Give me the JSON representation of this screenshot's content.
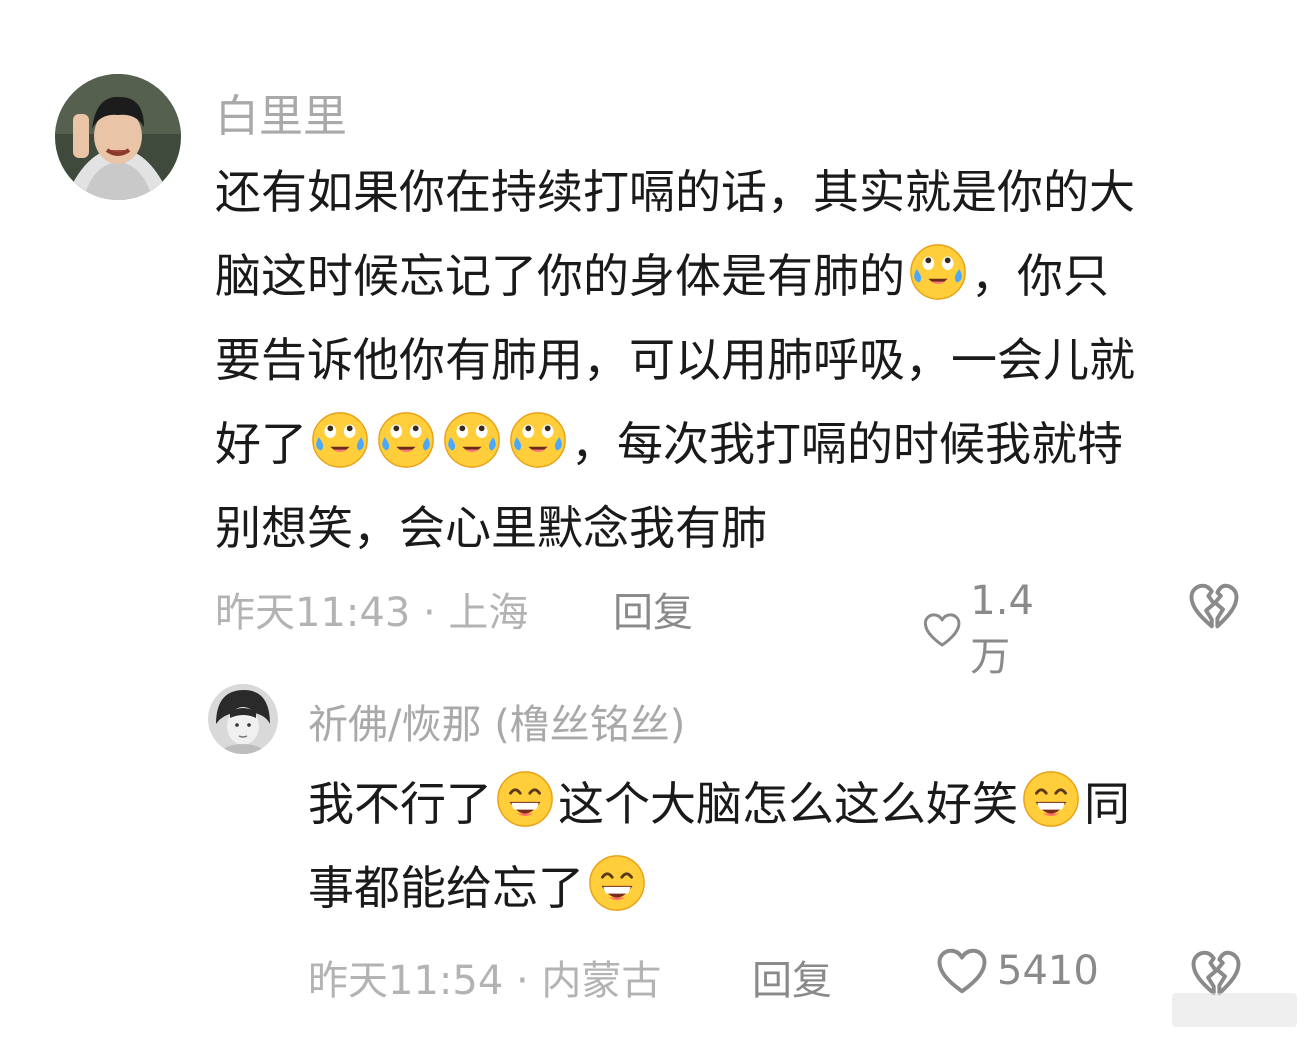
{
  "comments": [
    {
      "username": "白里里",
      "lines": [
        "还有如果你在持续打嗝的话，其实就是你的大",
        "脑这时候忘记了你的身体是有肺的",
        "，你只",
        "要告诉他你有肺用，可以用肺呼吸，一会儿就",
        "好了",
        "，每次我打嗝的时候我就特",
        "别想笑，会心里默念我有肺"
      ],
      "emoji": "laughing-crying-emoji",
      "timestamp": "昨天11:43 · 上海",
      "reply_label": "回复",
      "like_count": "1.4万"
    },
    {
      "username": "祈佛/恢那 (橹丝铭丝)",
      "lines": [
        "我不行了",
        "这个大脑怎么这么好笑",
        "同",
        "事都能给忘了"
      ],
      "emoji": "grinning-emoji",
      "timestamp": "昨天11:54 · 内蒙古",
      "reply_label": "回复",
      "like_count": "5410"
    }
  ],
  "colors": {
    "text": "#1a1a1a",
    "muted": "#a9a9a9",
    "icon": "#8a8a8a",
    "emoji_face": "#ffd13b"
  }
}
